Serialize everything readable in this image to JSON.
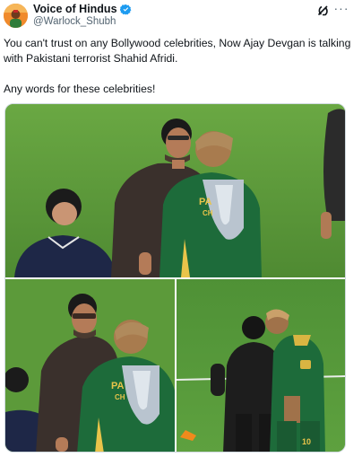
{
  "author": {
    "display_name": "Voice of Hindus",
    "handle": "@Warlock_Shubh",
    "verified": true,
    "verified_color": "#1d9bf0"
  },
  "actions": {
    "grok_icon": "grok-icon",
    "more_icon": "more-icon",
    "more_label": "···"
  },
  "tweet": {
    "text_line1": "You can't trust on any Bollywood celebrities, Now Ajay Devgan is talking with Pakistani terrorist Shahid Afridi.",
    "text_line2": "Any words for these celebrities!"
  },
  "media": {
    "photo_count": 3,
    "jersey_text": "PA",
    "jersey_text2": "CH",
    "jersey_number": "10"
  },
  "colors": {
    "text": "#0f1419",
    "secondary": "#536471",
    "grass": "#5f9a3c",
    "jersey_green": "#1d6b3a"
  }
}
